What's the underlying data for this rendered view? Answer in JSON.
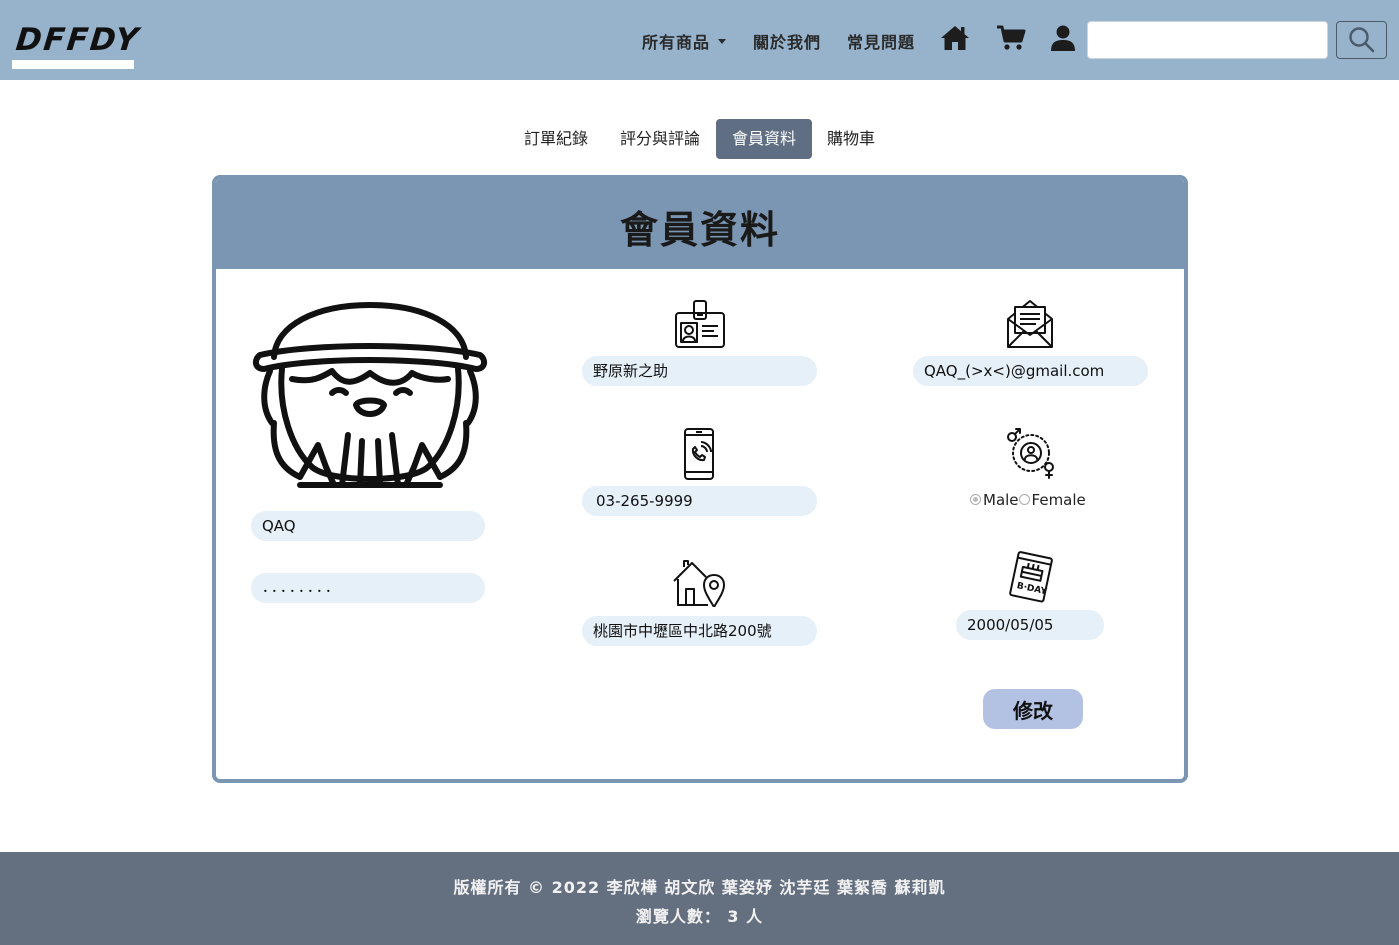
{
  "brand": {
    "logo_text": "DFFDY"
  },
  "nav": {
    "links": [
      {
        "label": "所有商品",
        "has_dropdown": true
      },
      {
        "label": "關於我們"
      },
      {
        "label": "常見問題"
      }
    ],
    "icons": [
      "home-icon",
      "cart-icon",
      "user-icon"
    ],
    "search": {
      "value": "",
      "placeholder": "",
      "button_icon": "search-icon"
    }
  },
  "tabs": [
    {
      "label": "訂單紀錄",
      "active": false
    },
    {
      "label": "評分與評論",
      "active": false
    },
    {
      "label": "會員資料",
      "active": true
    },
    {
      "label": "購物車",
      "active": false
    }
  ],
  "profile": {
    "title": "會員資料",
    "avatar_icon": "cartoon-avatar-icon",
    "username": "QAQ",
    "password_mask": "．．．．．．．．",
    "name": "野原新之助",
    "phone": "03-265-9999",
    "address": "桃園市中壢區中北路200號",
    "email": "QAQ_(>x<)@gmail.com",
    "gender": {
      "options": [
        "Male",
        "Female"
      ],
      "selected": "Male"
    },
    "birthday": "2000/05/05",
    "field_icons": [
      "id-card-icon",
      "phone-icon",
      "house-location-icon",
      "envelope-icon",
      "gender-icon",
      "birthday-card-icon"
    ],
    "edit_label": "修改"
  },
  "footer": {
    "copyright": "版權所有 © 2022 李欣樺 胡文欣 葉姿妤 沈芋廷 葉絮喬 蘇莉凱",
    "visitors": "瀏覽人數： 3 人"
  },
  "colors": {
    "navbar": "#97b3cc",
    "card_header": "#7b96b2",
    "active_tab": "#5f6e82",
    "pill": "#e6f0f8",
    "edit_button": "#b3c2e3",
    "footer": "#646f80"
  }
}
